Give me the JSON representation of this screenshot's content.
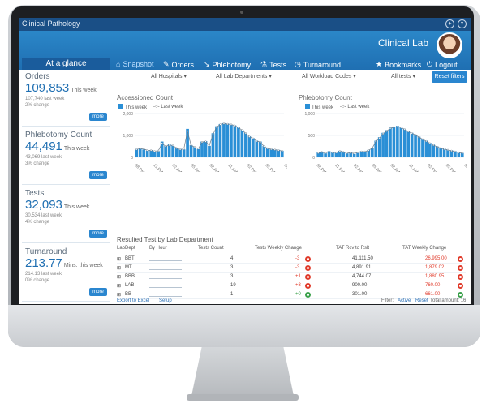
{
  "app_title": "Clinical Pathology",
  "brand": "Clinical Lab",
  "window_buttons": {
    "plus": "+",
    "close": "×"
  },
  "glance_label": "At a glance",
  "nav": [
    {
      "label": "Snapshot",
      "icon": "home-icon",
      "active": true
    },
    {
      "label": "Orders",
      "icon": "pencil-icon"
    },
    {
      "label": "Phlebotomy",
      "icon": "syringe-icon"
    },
    {
      "label": "Tests",
      "icon": "flask-icon"
    },
    {
      "label": "Turnaround",
      "icon": "clock-icon"
    },
    {
      "label": "Bookmarks",
      "icon": "star-icon"
    },
    {
      "label": "Logout",
      "icon": "power-icon"
    }
  ],
  "filters": {
    "hospitals": "All Hospitals ▾",
    "departments": "All Lab Departments ▾",
    "workload": "All Workload Codes ▾",
    "tests": "All tests ▾",
    "reset": "Reset filters"
  },
  "cards": [
    {
      "title": "Orders",
      "value": "109,853",
      "unit": "This week",
      "line1": "107,740 last week",
      "line2": "2% change",
      "more": "more"
    },
    {
      "title": "Phlebotomy Count",
      "value": "44,491",
      "unit": "This week",
      "line1": "43,069 last week",
      "line2": "3% change",
      "more": "more"
    },
    {
      "title": "Tests",
      "value": "32,093",
      "unit": "This week",
      "line1": "30,534 last week",
      "line2": "4% change",
      "more": "more"
    },
    {
      "title": "Turnaround",
      "value": "213.77",
      "unit": "Mins. this week",
      "line1": "214.13 last week",
      "line2": "0% change",
      "more": "more"
    }
  ],
  "legend": {
    "this_week": "This week",
    "last_week": "Last week"
  },
  "chart_data": [
    {
      "type": "bar",
      "title": "Accessioned Count",
      "ylim": [
        0,
        2000
      ],
      "yticks": [
        "2,000",
        "1,000",
        "0"
      ],
      "categories": [
        "08 PM",
        "11 PM",
        "02 AM",
        "05 AM",
        "08 AM",
        "11 AM",
        "02 PM",
        "05 PM",
        "08 PM"
      ],
      "series": [
        {
          "name": "This week",
          "values": [
            380,
            420,
            360,
            300,
            330,
            260,
            280,
            720,
            520,
            600,
            560,
            430,
            380,
            360,
            1300,
            560,
            480,
            380,
            720,
            740,
            520,
            1100,
            1420,
            1520,
            1560,
            1540,
            1480,
            1460,
            1380,
            1260,
            1120,
            960,
            880,
            760,
            720,
            520,
            420,
            380,
            360,
            340,
            300
          ]
        },
        {
          "name": "Last week",
          "values": [
            360,
            400,
            380,
            320,
            320,
            280,
            300,
            640,
            500,
            560,
            540,
            420,
            360,
            380,
            1200,
            540,
            470,
            400,
            700,
            720,
            540,
            1050,
            1380,
            1500,
            1540,
            1520,
            1500,
            1450,
            1360,
            1240,
            1100,
            940,
            860,
            740,
            700,
            500,
            410,
            370,
            350,
            320,
            290
          ]
        }
      ]
    },
    {
      "type": "bar",
      "title": "Phlebotomy Count",
      "ylim": [
        0,
        1000
      ],
      "yticks": [
        "1,000",
        "500",
        "0"
      ],
      "categories": [
        "08 PM",
        "11 PM",
        "02 AM",
        "05 AM",
        "08 AM",
        "11 AM",
        "02 PM",
        "05 PM",
        "08 PM"
      ],
      "series": [
        {
          "name": "This week",
          "values": [
            110,
            130,
            90,
            140,
            120,
            100,
            150,
            130,
            90,
            110,
            80,
            100,
            140,
            120,
            170,
            220,
            380,
            460,
            560,
            620,
            680,
            700,
            720,
            690,
            650,
            600,
            560,
            520,
            470,
            420,
            380,
            330,
            290,
            250,
            220,
            200,
            180,
            160,
            140,
            120,
            100
          ]
        },
        {
          "name": "Last week",
          "values": [
            100,
            120,
            100,
            130,
            110,
            110,
            140,
            120,
            100,
            100,
            90,
            110,
            130,
            130,
            160,
            210,
            360,
            440,
            540,
            600,
            660,
            690,
            700,
            680,
            640,
            590,
            550,
            510,
            460,
            410,
            370,
            320,
            280,
            240,
            210,
            190,
            170,
            150,
            130,
            110,
            95
          ]
        }
      ]
    }
  ],
  "table": {
    "title": "Resulted Test by Lab Department",
    "headers": [
      "LabDept",
      "By Hour",
      "Tests Count",
      "Tests Weekly Change",
      "TAT Rcv to Rslt",
      "TAT Weekly Change"
    ],
    "rows": [
      {
        "dept": "BBT",
        "count": "4",
        "change": "-3",
        "tat": "41,111.50",
        "tat_change": "26,995.00",
        "ok": false
      },
      {
        "dept": "MT",
        "count": "3",
        "change": "-3",
        "tat": "4,891.91",
        "tat_change": "1,879.02",
        "ok": false
      },
      {
        "dept": "BBB",
        "count": "3",
        "change": "+1",
        "tat": "4,744.07",
        "tat_change": "1,880.95",
        "ok": false
      },
      {
        "dept": "LAB",
        "count": "19",
        "change": "+3",
        "tat": "900.00",
        "tat_change": "760.00",
        "ok": false
      },
      {
        "dept": "BB",
        "count": "1",
        "change": "+0",
        "tat": "301.00",
        "tat_change": "661.00",
        "ok": true
      }
    ],
    "export": "Export to Excel",
    "setup": "Setup",
    "filter_label": "Filter:",
    "filter_active": "Active",
    "filter_reset": "Reset",
    "total": "Total amount: 16"
  }
}
